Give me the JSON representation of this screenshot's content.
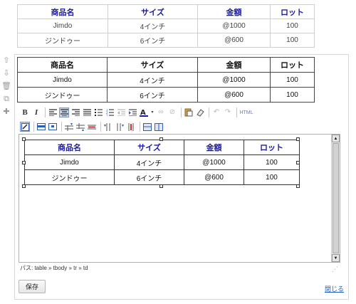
{
  "preview_table": {
    "headers": [
      "商品名",
      "サイズ",
      "金額",
      "ロット"
    ],
    "rows": [
      [
        "Jimdo",
        "4インチ",
        "@1000",
        "100"
      ],
      [
        "ジンドゥー",
        "6インチ",
        "@600",
        "100"
      ]
    ]
  },
  "side_tools": [
    {
      "name": "move-up-icon",
      "glyph": "⇧"
    },
    {
      "name": "move-down-icon",
      "glyph": "⇩"
    },
    {
      "name": "delete-icon",
      "glyph": "🗑"
    },
    {
      "name": "copy-icon",
      "glyph": "⧉"
    },
    {
      "name": "add-icon",
      "glyph": "✚"
    }
  ],
  "edit_table": {
    "headers": [
      "商品名",
      "サイズ",
      "金額",
      "ロット"
    ],
    "rows": [
      [
        "Jimdo",
        "4インチ",
        "@1000",
        "100"
      ],
      [
        "ジンドゥー",
        "6インチ",
        "@600",
        "100"
      ]
    ]
  },
  "toolbar": {
    "bold": "B",
    "italic": "I",
    "html": "HTML"
  },
  "editor_table": {
    "headers": [
      "商品名",
      "サイズ",
      "金額",
      "ロット"
    ],
    "rows": [
      [
        "Jimdo",
        "4インチ",
        "@1000",
        "100"
      ],
      [
        "ジンドゥー",
        "6インチ",
        "@600",
        "100"
      ]
    ]
  },
  "path_bar": "パス: table » tbody » tr » td",
  "save_label": "保存",
  "close_label": "閉じる",
  "colors": {
    "header_text": "#1a1aa6",
    "link": "#1a5dc9",
    "selected_tool": "#c9d3e6"
  }
}
